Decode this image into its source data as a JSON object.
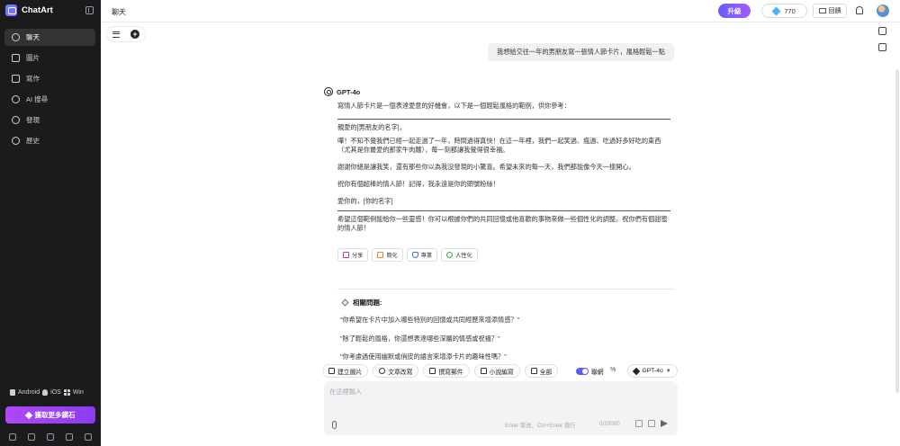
{
  "app": {
    "name": "ChatArt"
  },
  "sidebar": {
    "items": [
      {
        "label": "聊天",
        "icon": "chat-icon",
        "active": true
      },
      {
        "label": "圖片",
        "icon": "image-icon"
      },
      {
        "label": "寫作",
        "icon": "pen-icon"
      },
      {
        "label": "AI 搜尋",
        "icon": "ai-search-icon"
      },
      {
        "label": "發現",
        "icon": "compass-icon"
      },
      {
        "label": "歷史",
        "icon": "history-icon"
      }
    ],
    "platforms": [
      "Android",
      "iOS",
      "Win"
    ],
    "promo_label": "獲取更多鑽石"
  },
  "header": {
    "title": "聊天",
    "upgrade_label": "升級",
    "credits": "770",
    "feedback_label": "回饋"
  },
  "conversation": {
    "user_message": "我想給交往一年的男朋友寫一張情人節卡片，風格輕鬆一點",
    "bot_name": "GPT-4o",
    "intro": "寫情人節卡片是一個表達愛意的好機會，以下是一個輕鬆風格的範例，供你參考：",
    "card": {
      "greeting": "親愛的[男朋友的名字]，",
      "p1": "嘩！不知不覺我們已經一起走過了一年，時間過得真快！在這一年裡，我們一起笑過、瘋過、吃過好多好吃的東西（尤其是你最愛的那家牛肉麵），每一刻都讓我覺得很幸福。",
      "p2": "謝謝你總是讓我笑，還有那些你以為我沒發現的小驚喜。希望未來的每一天，我們都能像今天一樣開心。",
      "p3": "祝你有個超棒的情人節！記得，我永遠是你的頭號粉絲！",
      "closing": "愛你的，[你的名字]"
    },
    "outro": "希望這個範例能給你一些靈感！你可以根據你們的共同回憶或他喜歡的事物來做一些個性化的調整。祝你們有個甜蜜的情人節！",
    "actions": [
      {
        "label": "分享",
        "icon": "share-icon"
      },
      {
        "label": "簡化",
        "icon": "simplify-icon"
      },
      {
        "label": "專業",
        "icon": "shield-icon"
      },
      {
        "label": "人性化",
        "icon": "humanize-icon"
      }
    ],
    "related_title": "相關問題:",
    "related": [
      "\"你希望在卡片中加入哪些特別的回憶或共同經歷來增添情感？\"",
      "\"除了輕鬆的風格，你還想表達哪些深層的情感或祝福？\"",
      "\"你考慮過使用幽默或俏皮的語言來增添卡片的趣味性嗎？\""
    ]
  },
  "composer": {
    "chips": [
      {
        "label": "建立圖片",
        "icon": "image-icon"
      },
      {
        "label": "文章改寫",
        "icon": "rewrite-icon"
      },
      {
        "label": "撰寫郵件",
        "icon": "mail-icon"
      },
      {
        "label": "小說編寫",
        "icon": "book-icon"
      },
      {
        "label": "全部",
        "icon": "grid-icon"
      }
    ],
    "toggle_label": "聯網",
    "percent_symbol": "%",
    "model": "GPT-4o",
    "placeholder": "在這裡輸入",
    "hint": "Enter 發送，Ctrl+Enter 換行",
    "counter": "0/20000"
  }
}
